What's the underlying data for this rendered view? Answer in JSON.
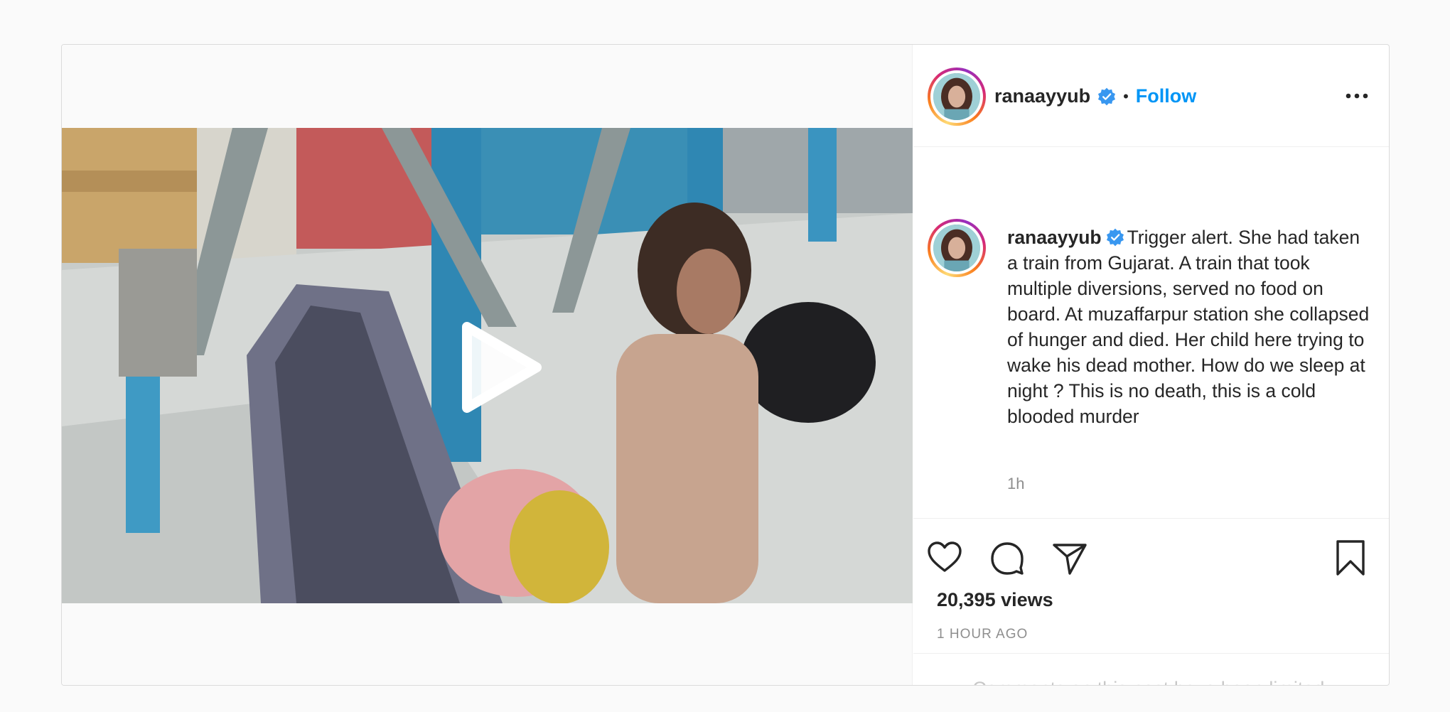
{
  "post": {
    "username": "ranaayyub",
    "follow_label": "Follow",
    "separator": "•",
    "caption": "Trigger alert. She had taken a train from Gujarat. A train that took multiple diversions, served no food on board. At muzaffarpur station she collapsed of hunger and died. Her child here trying to wake his dead mother. How do we sleep at night ? This is no death, this is a cold blooded murder",
    "time_short": "1h",
    "views": "20,395 views",
    "posted_ago": "1 HOUR AGO",
    "comments_notice": "Comments on this post have been limited."
  },
  "icons": {
    "verified": "verified-badge-icon",
    "more": "more-options-icon",
    "like": "heart-icon",
    "comment": "comment-bubble-icon",
    "share": "paper-plane-icon",
    "save": "bookmark-icon",
    "play": "play-icon"
  },
  "colors": {
    "accent": "#0095f6",
    "verified": "#3897f0",
    "text": "#262626",
    "muted": "#8e8e8e",
    "border": "#dbdbdb"
  }
}
